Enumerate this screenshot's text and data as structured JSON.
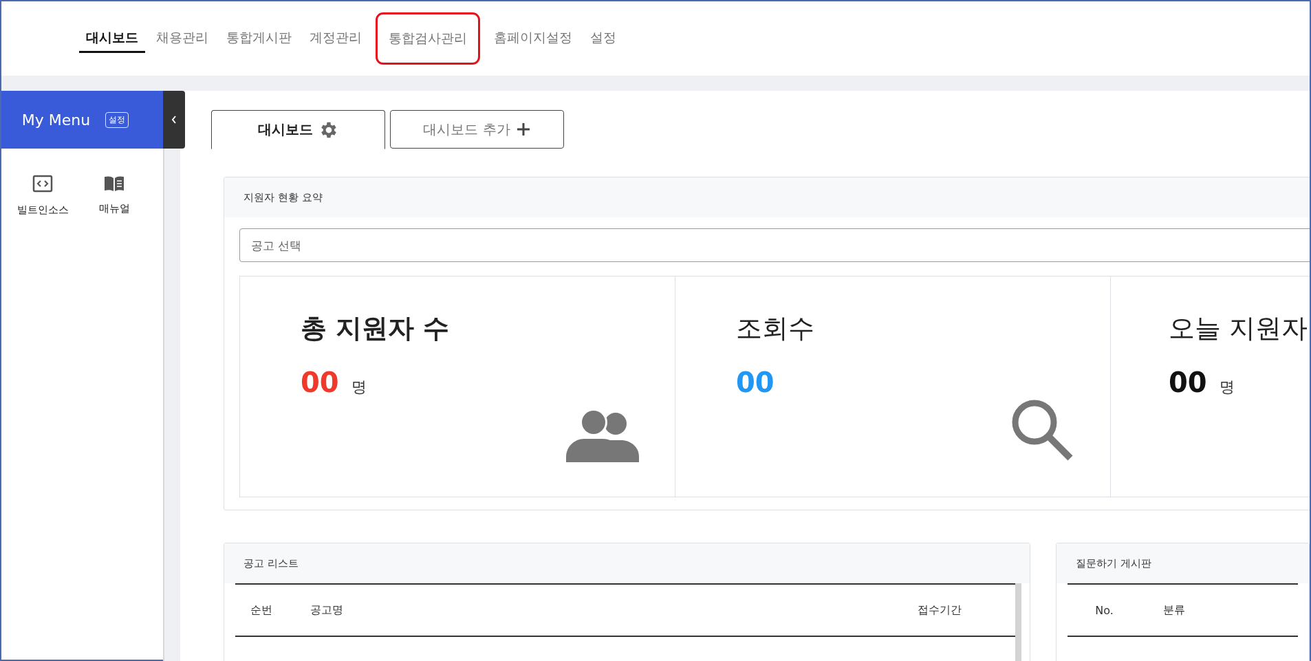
{
  "top_nav": [
    {
      "label": "대시보드",
      "selected": true,
      "highlighted": false
    },
    {
      "label": "채용관리",
      "selected": false,
      "highlighted": false
    },
    {
      "label": "통합게시판",
      "selected": false,
      "highlighted": false
    },
    {
      "label": "계정관리",
      "selected": false,
      "highlighted": false
    },
    {
      "label": "통합검사관리",
      "selected": false,
      "highlighted": true
    },
    {
      "label": "홈페이지설정",
      "selected": false,
      "highlighted": false
    },
    {
      "label": "설정",
      "selected": false,
      "highlighted": false
    }
  ],
  "sidebar": {
    "title": "My Menu",
    "settings_badge": "설정",
    "items": [
      {
        "label": "빌트인소스",
        "kind": "code"
      },
      {
        "label": "매뉴얼",
        "kind": "book"
      }
    ]
  },
  "dashboard_tabs": [
    {
      "label": "대시보드",
      "kind": "settings",
      "selected": true
    },
    {
      "label": "대시보드 추가",
      "kind": "add",
      "selected": false
    }
  ],
  "summary": {
    "title": "지원자 현황 요약",
    "select": {
      "placeholder": "공고 선택"
    },
    "stats": [
      {
        "title": "총 지원자 수",
        "value": "00",
        "unit": "명",
        "color": "#f0392b",
        "kind": "users",
        "bold_title": true
      },
      {
        "title": "조회수",
        "value": "00",
        "color": "#2196f3",
        "kind": "search",
        "bold_title": false
      },
      {
        "title": "오늘 지원자",
        "value": "00",
        "unit": "명",
        "color": "#111111",
        "kind": "none",
        "bold_title": false
      }
    ]
  },
  "posting_list": {
    "title": "공고 리스트",
    "columns": [
      "순번",
      "공고명",
      "접수기간"
    ]
  },
  "question_board": {
    "title": "질문하기 게시판",
    "columns": [
      "No.",
      "분류"
    ]
  }
}
